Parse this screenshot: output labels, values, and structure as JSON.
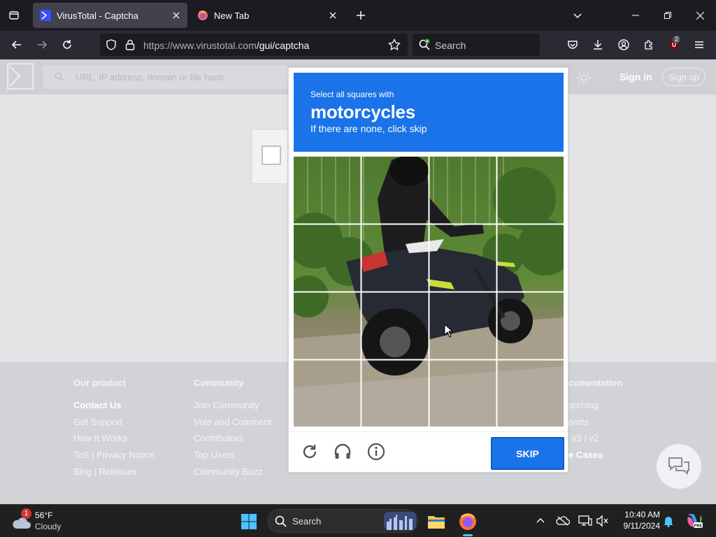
{
  "browser": {
    "tabs": [
      {
        "title": "VirusTotal - Captcha",
        "active": true
      },
      {
        "title": "New Tab",
        "active": false
      }
    ],
    "url": {
      "host": "https://www.virustotal.com",
      "path": "/gui/captcha"
    },
    "search_placeholder": "Search",
    "extension_badge": "2"
  },
  "site": {
    "search_placeholder": "URL, IP address, domain or file hash",
    "sign_in": "Sign in",
    "sign_up": "Sign up",
    "footer": [
      {
        "heading": "Our product",
        "links": [
          "Contact Us",
          "Get Support",
          "How It Works",
          "ToS | Privacy Notice",
          "Blog | Releases"
        ]
      },
      {
        "heading": "Community",
        "links": [
          "Join Community",
          "Vote and Comment",
          "Contributors",
          "Top Users",
          "Community Buzz"
        ]
      },
      {
        "heading": "cumentation",
        "links": [
          "arching",
          "ports",
          "v3 | v2",
          "e Cases"
        ]
      }
    ]
  },
  "captcha": {
    "instruction_line1": "Select all squares with",
    "target": "motorcycles",
    "instruction_line3": "If there are none, click skip",
    "skip_label": "SKIP",
    "grid_rows": 4,
    "grid_cols": 4
  },
  "taskbar": {
    "weather": {
      "badge": "1",
      "temp": "56°F",
      "condition": "Cloudy"
    },
    "search_placeholder": "Search",
    "time": "10:40 AM",
    "date": "9/11/2024"
  },
  "colors": {
    "captcha_accent": "#1a73e8",
    "browser_chrome": "#2b2a33"
  }
}
